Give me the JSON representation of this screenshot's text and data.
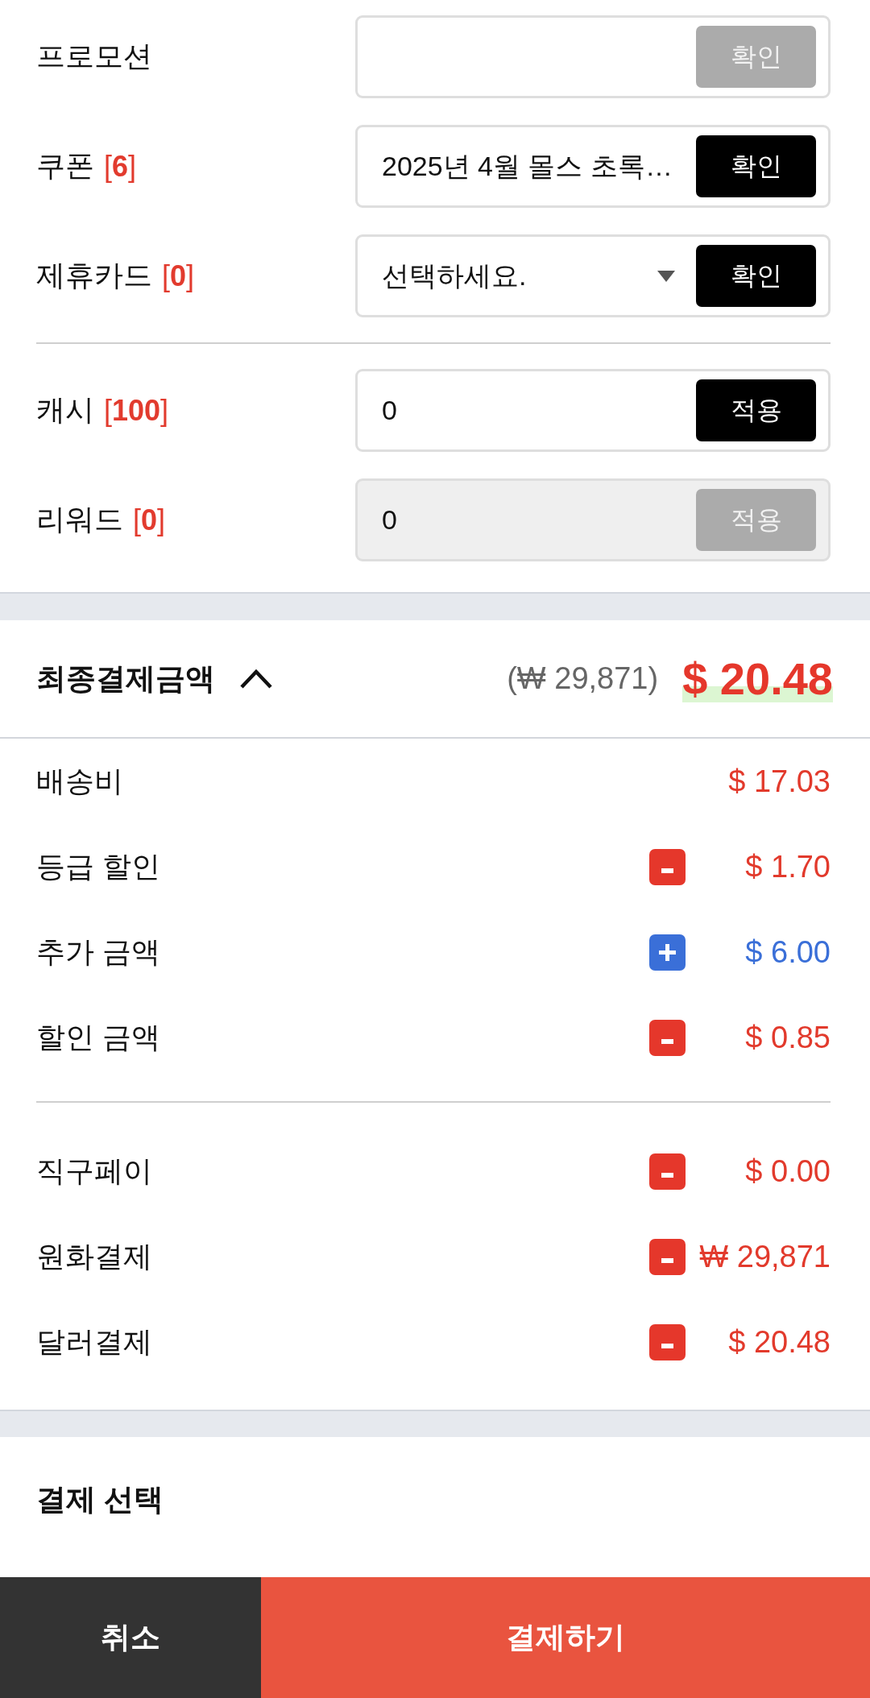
{
  "form": {
    "groups": [
      {
        "rows": [
          {
            "kind": "input",
            "label": "프로모션",
            "disabled": false,
            "button": {
              "label": "확인",
              "disabled": true
            }
          },
          {
            "kind": "input",
            "label": "쿠폰",
            "count": "[**6**]",
            "value": "2025년 4월 몰스 초록…",
            "disabled": false,
            "button": {
              "label": "확인",
              "disabled": false
            }
          },
          {
            "kind": "select",
            "label": "제휴카드",
            "count": "[**0**]",
            "value": "선택하세요.",
            "disabled": false,
            "button": {
              "label": "확인",
              "disabled": false
            }
          }
        ]
      },
      {
        "rows": [
          {
            "kind": "input",
            "label": "캐시",
            "count": "[**100**]",
            "value": "0",
            "disabled": false,
            "button": {
              "label": "적용",
              "disabled": false
            }
          },
          {
            "kind": "input",
            "label": "리워드",
            "count": "[**0**]",
            "value": "0",
            "disabled": true,
            "button": {
              "label": "적용",
              "disabled": true
            }
          }
        ]
      }
    ]
  },
  "summary": {
    "title": "최종결제금액",
    "expanded": true,
    "total_krw": "(₩ 29,871)",
    "total_usd": "$ 20.48",
    "groups": [
      {
        "lines": [
          {
            "kind": "plain",
            "label": "배송비",
            "amount": "$ 17.03"
          },
          {
            "kind": "minus",
            "label": "등급 할인",
            "amount": "$ 1.70"
          },
          {
            "kind": "plus",
            "label": "추가 금액",
            "amount": "$ 6.00"
          },
          {
            "kind": "minus",
            "label": "할인 금액",
            "amount": "$ 0.85"
          }
        ]
      },
      {
        "lines": [
          {
            "kind": "minus",
            "label": "직구페이",
            "amount": "$ 0.00"
          },
          {
            "kind": "minus",
            "label": "원화결제",
            "amount": "₩ 29,871"
          },
          {
            "kind": "minus",
            "label": "달러결제",
            "amount": "$ 20.48"
          }
        ]
      }
    ]
  },
  "payment": {
    "title": "결제 선택"
  },
  "footer": {
    "buttons": [
      {
        "kind": "cancel",
        "label": "취소"
      },
      {
        "kind": "primary",
        "label": "결제하기"
      }
    ]
  }
}
